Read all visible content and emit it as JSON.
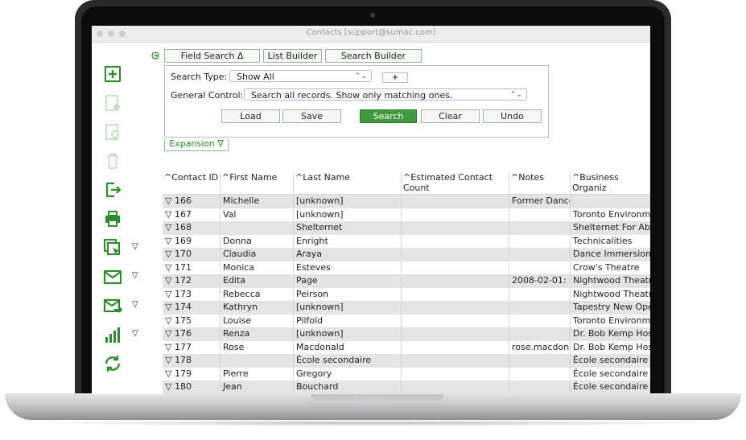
{
  "window": {
    "title": "Contacts    [support@sumac.com]"
  },
  "device": {
    "brand": "MacBook"
  },
  "sidebar": {
    "items": [
      {
        "icon": "add-icon",
        "enabled": true,
        "dropdown": ""
      },
      {
        "icon": "edit-record-icon",
        "enabled": false,
        "dropdown": ""
      },
      {
        "icon": "settings-record-icon",
        "enabled": false,
        "dropdown": ""
      },
      {
        "icon": "trash-icon",
        "enabled": false,
        "dropdown": ""
      },
      {
        "icon": "export-icon",
        "enabled": true,
        "dropdown": ""
      },
      {
        "icon": "print-icon",
        "enabled": true,
        "dropdown": ""
      },
      {
        "icon": "select-records-icon",
        "enabled": true,
        "dropdown": "▽"
      },
      {
        "icon": "email-icon",
        "enabled": true,
        "dropdown": "▽"
      },
      {
        "icon": "email-send-icon",
        "enabled": true,
        "dropdown": "▽"
      },
      {
        "icon": "stats-icon",
        "enabled": true,
        "dropdown": "▽"
      },
      {
        "icon": "refresh-icon",
        "enabled": true,
        "dropdown": ""
      }
    ]
  },
  "search": {
    "tabs": [
      "Field Search Δ",
      "List Builder",
      "Search Builder"
    ],
    "search_type_label": "Search Type:",
    "search_type_value": "Show All",
    "plus_label": "+",
    "general_control_label": "General Control:",
    "general_control_value": "Search all records. Show only matching ones.",
    "buttons": {
      "load": "Load",
      "save": "Save",
      "search": "Search",
      "clear": "Clear",
      "undo": "Undo"
    },
    "expansion_label": "Expansion ∇"
  },
  "table": {
    "columns": [
      "^Contact ID",
      "^First Name",
      "^Last Name",
      "^Estimated Contact Count",
      "^Notes",
      "^Business Organiz"
    ],
    "rows": [
      [
        "▽ 166",
        "Michelle",
        "[unknown]",
        "",
        "Former Dance",
        ""
      ],
      [
        "▽ 167",
        "Val",
        "[unknown]",
        "",
        "",
        "Toronto Environm"
      ],
      [
        "▽ 168",
        "",
        "Shelternet",
        "",
        "",
        "Shelternet For Abu"
      ],
      [
        "▽ 169",
        "Donna",
        "Enright",
        "",
        "",
        "Technicalities"
      ],
      [
        "▽ 170",
        "Claudia",
        "Araya",
        "",
        "",
        "Dance Immersion"
      ],
      [
        "▽ 171",
        "Monica",
        "Esteves",
        "",
        "",
        "Crow's Theatre"
      ],
      [
        "▽ 172",
        "Edita",
        "Page",
        "",
        "2008-02-01:",
        "Nightwood Theatre"
      ],
      [
        "▽ 173",
        "Rebecca",
        "Peirson",
        "",
        "",
        "Nightwood Theatre"
      ],
      [
        "▽ 174",
        "Kathryn",
        "[unknown]",
        "",
        "",
        "Tapestry New Ope"
      ],
      [
        "▽ 175",
        "Louise",
        "Pilfold",
        "",
        "",
        "Toronto Environm"
      ],
      [
        "▽ 176",
        "Renza",
        "[unknown]",
        "",
        "",
        "Dr. Bob Kemp Hosp"
      ],
      [
        "▽ 177",
        "Rose",
        "Macdonald",
        "",
        "rose.macdon",
        "Dr. Bob Kemp Hosp"
      ],
      [
        "▽ 178",
        "",
        "École secondaire",
        "",
        "",
        "École secondaire c"
      ],
      [
        "▽ 179",
        "Pierre",
        "Gregory",
        "",
        "",
        "École secondaire c"
      ],
      [
        "▽ 180",
        "Jean",
        "Bouchard",
        "",
        "",
        "École secondaire c"
      ]
    ]
  },
  "colors": {
    "accent": "#2e8b2e",
    "search_button": "#3f9a3f"
  }
}
